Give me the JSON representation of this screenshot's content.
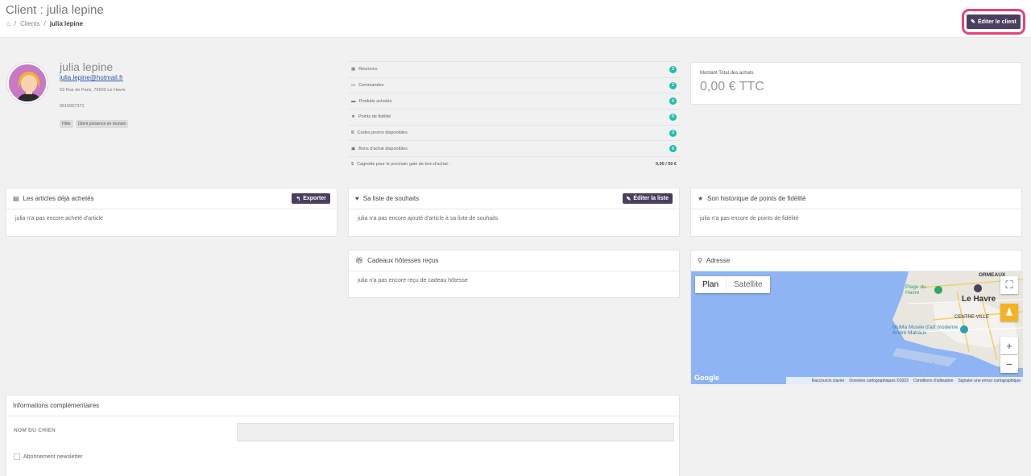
{
  "header": {
    "title": "Client : julia lepine",
    "breadcrumb": [
      "Clients",
      "julia lepine"
    ],
    "edit_button": "Éditer le client"
  },
  "profile": {
    "name": "julia lepine",
    "email": "julia.lepine@hotmail.fr",
    "address": "63 Rue de Paris, 76600 Le Havre",
    "phone": "0615067371",
    "tags": [
      "Hôte",
      "Client présence en réunion"
    ]
  },
  "stats": [
    {
      "icon": "calendar-icon",
      "glyph": "▦",
      "label": "Réunions",
      "value": "3"
    },
    {
      "icon": "credit-card-icon",
      "glyph": "▭",
      "label": "Commandes",
      "value": "2"
    },
    {
      "icon": "box-icon",
      "glyph": "▬",
      "label": "Produits achetés",
      "value": "0"
    },
    {
      "icon": "star-icon",
      "glyph": "★",
      "label": "Points de fidélité",
      "value": "0"
    },
    {
      "icon": "barcode-icon",
      "glyph": "Ⅲ",
      "label": "Codes promo disponibles",
      "value": "3"
    },
    {
      "icon": "voucher-icon",
      "glyph": "▣",
      "label": "Bons d'achat disponibles",
      "value": "0"
    }
  ],
  "jackpot": {
    "label": "Cagnotte pour le prochain gain de bon d'achat :",
    "value": "0,00 / 50 €"
  },
  "total": {
    "label": "Montant Total des achats",
    "value": "0,00 € TTC"
  },
  "articles": {
    "title": "Les articles déjà achetés",
    "button": "Exporter",
    "empty": "julia n'a pas encore acheté d'article"
  },
  "wishlist": {
    "title": "Sa liste de souhaits",
    "button": "Éditer la liste",
    "empty": "julia n'a pas encore ajouté d'article à sa liste de souhaits"
  },
  "points_history": {
    "title": "Son historique de points de fidélité",
    "empty": "julia n'a pas encore de points de fidélité"
  },
  "gifts": {
    "title": "Cadeaux hôtesses reçus",
    "empty": "julia n'a pas encore reçu de cadeau hôtesse"
  },
  "address_card": {
    "title": "Adresse",
    "map_tabs": [
      "Plan",
      "Satellite"
    ],
    "map_labels": [
      "ORMEAUX",
      "Plage du Havre",
      "Le Havre",
      "CENTRE-VILLE",
      "MuMa Musée d'art moderne André Malraux"
    ],
    "footer": [
      "Raccourcis clavier",
      "Données cartographiques ©2023",
      "Conditions d'utilisation",
      "Signaler une erreur cartographique"
    ],
    "google_logo": "Google"
  },
  "extra": {
    "title": "Informations complémentaires",
    "field_label": "NOM DU CHIEN",
    "field_value": "",
    "checkbox_label": "Abonnement newsletter"
  },
  "colors": {
    "accent": "#4b3f5f",
    "badge": "#1ebfac",
    "highlight": "#e8427c",
    "map_water": "#8fb4f4"
  }
}
